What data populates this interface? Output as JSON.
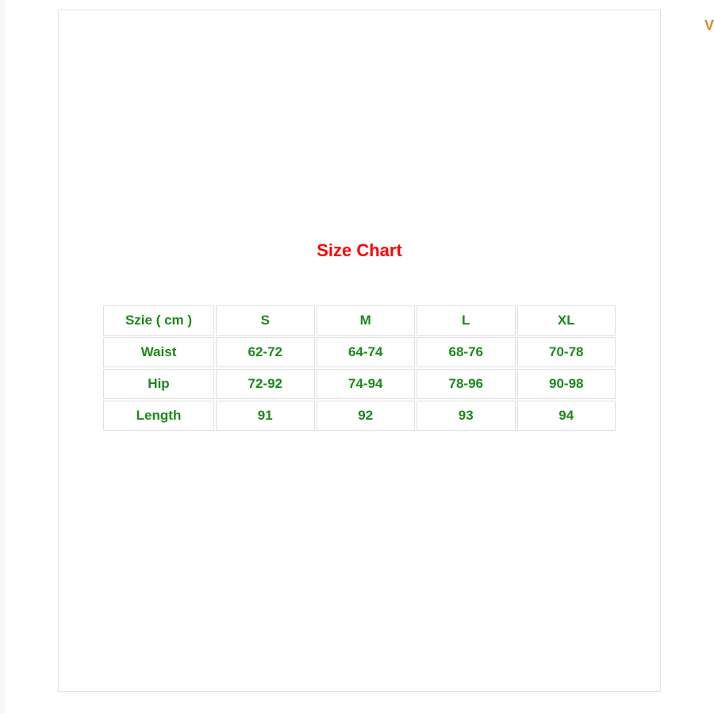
{
  "title": "Size Chart",
  "edge_char": "V",
  "chart_data": {
    "type": "table",
    "title": "Size Chart",
    "columns": [
      "Szie ( cm )",
      "S",
      "M",
      "L",
      "XL"
    ],
    "rows": [
      {
        "label": "Waist",
        "values": [
          "62-72",
          "64-74",
          "68-76",
          "70-78"
        ]
      },
      {
        "label": "Hip",
        "values": [
          "72-92",
          "74-94",
          "78-96",
          "90-98"
        ]
      },
      {
        "label": "Length",
        "values": [
          "91",
          "92",
          "93",
          "94"
        ]
      }
    ]
  }
}
